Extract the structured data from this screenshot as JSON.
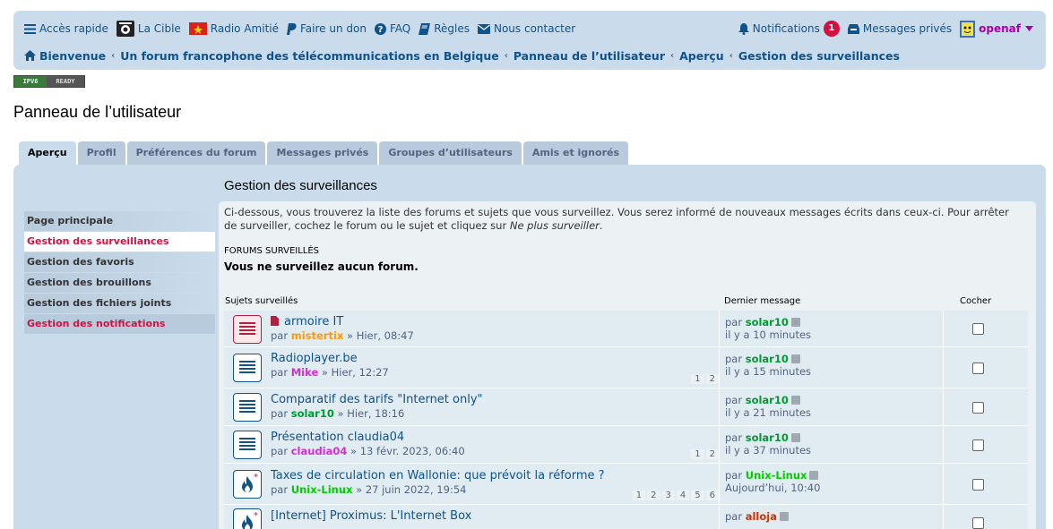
{
  "nav": {
    "quick_access": "Accès rapide",
    "la_cible": "La Cible",
    "radio": "Radio Amitié",
    "donate": "Faire un don",
    "faq": "FAQ",
    "rules": "Règles",
    "contact": "Nous contacter",
    "notifications": "Notifications",
    "notifications_count": "1",
    "pm": "Messages privés",
    "username": "openaf"
  },
  "breadcrumb": [
    "Bienvenue",
    "Un forum francophone des télécommunications en Belgique",
    "Panneau de l’utilisateur",
    "Aperçu",
    "Gestion des surveillances"
  ],
  "badge": {
    "left": "IPV6",
    "right": "READY"
  },
  "page_title": "Panneau de l’utilisateur",
  "tabs": [
    "Aperçu",
    "Profil",
    "Préférences du forum",
    "Messages privés",
    "Groupes d’utilisateurs",
    "Amis et ignorés"
  ],
  "sidebar": [
    "Page principale",
    "Gestion des surveillances",
    "Gestion des favoris",
    "Gestion des brouillons",
    "Gestion des fichiers joints",
    "Gestion des notifications"
  ],
  "main": {
    "title": "Gestion des surveillances",
    "description": "Ci-dessous, vous trouverez la liste des forums et sujets que vous surveillez. Vous serez informé de nouveaux messages écrits dans ceux-ci. Pour arrêter de surveiller, cochez le forum ou le sujet et cliquez sur ",
    "description_em": "Ne plus surveiller",
    "description_end": ".",
    "forums_head": "Forums surveillés",
    "no_forums": "Vous ne surveillez aucun forum.",
    "topics_head": "Sujets surveillés",
    "last_head": "Dernier message",
    "check_head": "Cocher"
  },
  "topics": [
    {
      "title": "armoire IT",
      "by": "par",
      "author": "mistertix",
      "author_color": "#ff9900",
      "date": "» Hier, 08:47",
      "pages": [],
      "last_by": "par",
      "last_author": "solar10",
      "last_color": "#009933",
      "last_time": "il y a 10 minutes",
      "icon": "unread-topic-icon"
    },
    {
      "title": "Radioplayer.be",
      "by": "par",
      "author": "Mike",
      "author_color": "#cc33cc",
      "date": "» Hier, 12:27",
      "pages": [
        "1",
        "2"
      ],
      "last_by": "par",
      "last_author": "solar10",
      "last_color": "#009933",
      "last_time": "il y a 15 minutes",
      "icon": "topic-icon"
    },
    {
      "title": "Comparatif des tarifs \"Internet only\"",
      "by": "par",
      "author": "solar10",
      "author_color": "#009933",
      "date": "» Hier, 18:16",
      "pages": [],
      "last_by": "par",
      "last_author": "solar10",
      "last_color": "#009933",
      "last_time": "il y a 21 minutes",
      "icon": "topic-icon"
    },
    {
      "title": "Présentation claudia04",
      "by": "par",
      "author": "claudia04",
      "author_color": "#cc33cc",
      "date": "» 13 févr. 2023, 06:40",
      "pages": [
        "1",
        "2"
      ],
      "last_by": "par",
      "last_author": "solar10",
      "last_color": "#009933",
      "last_time": "il y a 37 minutes",
      "icon": "topic-icon"
    },
    {
      "title": "Taxes de circulation en Wallonie: que prévoit la réforme ?",
      "by": "par",
      "author": "Unix-Linux",
      "author_color": "#00cc00",
      "date": "» 27 juin 2022, 19:54",
      "pages": [
        "1",
        "2",
        "3",
        "4",
        "5",
        "6"
      ],
      "last_by": "par",
      "last_author": "Unix-Linux",
      "last_color": "#00cc00",
      "last_time": "Aujourd’hui, 10:40",
      "icon": "hot-topic-icon"
    },
    {
      "title": "[Internet] Proximus: L'Internet Box",
      "by": "",
      "author": "",
      "author_color": "#333333",
      "date": "",
      "pages": [],
      "last_by": "par",
      "last_author": "alloja",
      "last_color": "#cc3300",
      "last_time": "",
      "icon": "hot-topic-icon"
    }
  ]
}
